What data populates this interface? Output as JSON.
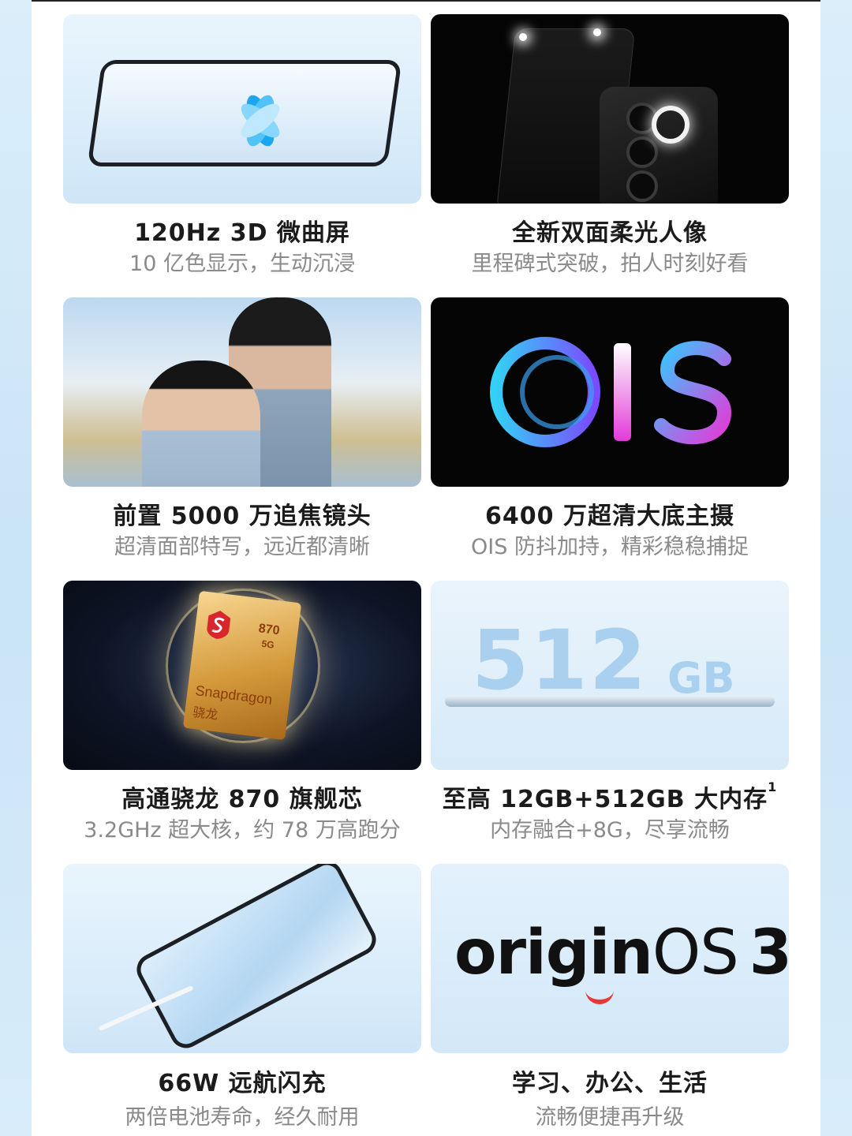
{
  "features": [
    {
      "title": "120Hz 3D 微曲屏",
      "subtitle": "10 亿色显示，生动沉浸"
    },
    {
      "title": "全新双面柔光人像",
      "subtitle": "里程碑式突破，拍人时刻好看"
    },
    {
      "title": "前置 5000 万追焦镜头",
      "subtitle": "超清面部特写，远近都清晰"
    },
    {
      "title": "6400 万超清大底主摄",
      "subtitle": "OIS 防抖加持，精彩稳稳捕捉"
    },
    {
      "title": "高通骁龙 870 旗舰芯",
      "subtitle": "3.2GHz 超大核，约 78 万高跑分"
    },
    {
      "title": "至高 12GB+512GB 大内存",
      "footnote": "1",
      "subtitle": "内存融合+8G，尽享流畅"
    },
    {
      "title": "66W 远航闪充",
      "subtitle": "两倍电池寿命，经久耐用"
    },
    {
      "title": "学习、办公、生活",
      "subtitle": "流畅便捷再升级"
    }
  ],
  "images": {
    "ois_text": "OIS",
    "chip_model": "870",
    "chip_5g": "5G",
    "chip_brand": "Snapdragon",
    "chip_cn": "骁龙",
    "storage_big": "512",
    "storage_unit": "GB",
    "os_logo_word": "origin",
    "os_logo_os": "OS",
    "os_logo_num": "3"
  },
  "colors": {
    "side_blue": "#cfe6f8",
    "title_text": "#1b1b1b",
    "subtitle_text": "#8a8a8a",
    "os_accent_red": "#e53935",
    "ois_cyan": "#34d0f5",
    "ois_magenta": "#e33bd8"
  }
}
